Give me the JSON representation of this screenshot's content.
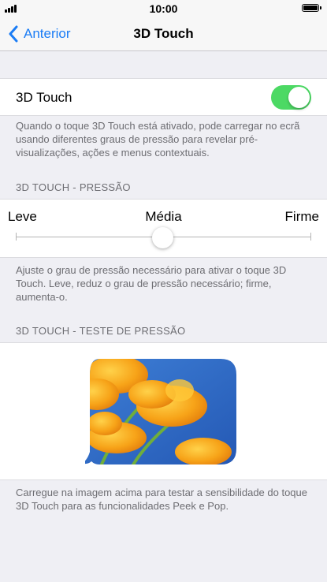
{
  "status_bar": {
    "time": "10:00"
  },
  "nav": {
    "back_label": "Anterior",
    "title": "3D Touch"
  },
  "toggle_section": {
    "label": "3D Touch",
    "enabled": true,
    "footer": "Quando o toque 3D Touch está ativado, pode carregar no ecrã usando diferentes graus de pressão para revelar pré-visualizações, ações e menus contextuais."
  },
  "pressure_section": {
    "header": "3D TOUCH - PRESSÃO",
    "options": [
      "Leve",
      "Média",
      "Firme"
    ],
    "selected": "Média",
    "footer": "Ajuste o grau de pressão necessário para ativar o toque 3D Touch. Leve, reduz o grau de pressão necessário; firme, aumenta-o."
  },
  "test_section": {
    "header": "3D TOUCH - TESTE DE PRESSÃO",
    "image_icon": "orange-poppies-photo",
    "footer": "Carregue na imagem acima para testar a sensibilidade do toque 3D Touch para as funcionalidades Peek e Pop."
  },
  "colors": {
    "accent": "#1a7cf5",
    "switch_on": "#4cd964",
    "background": "#efeff4",
    "secondary_text": "#6d6d72"
  }
}
